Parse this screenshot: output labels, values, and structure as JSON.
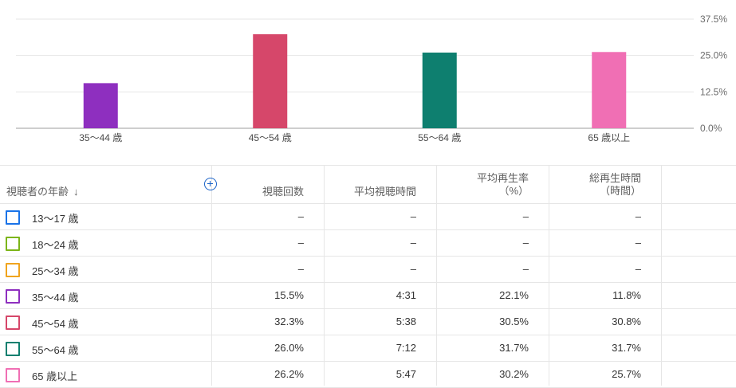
{
  "chart_data": {
    "type": "bar",
    "categories": [
      "35～44 歳",
      "45～54 歳",
      "55～64 歳",
      "65 歳以上"
    ],
    "values": [
      15.5,
      32.3,
      26.0,
      26.2
    ],
    "colors": [
      "#8e2fbf",
      "#d6476a",
      "#0e7f6f",
      "#f06fb4"
    ],
    "yticks": [
      "37.5%",
      "25.0%",
      "12.5%",
      "0.0%"
    ],
    "ylim": [
      0,
      37.5
    ],
    "grid": true
  },
  "table": {
    "headers": {
      "age": "視聴者の年齢",
      "views": "視聴回数",
      "avg_duration": "平均視聴時間",
      "avg_pct_1": "平均再生率",
      "avg_pct_2": "（%）",
      "watch_time_1": "総再生時間",
      "watch_time_2": "（時間）"
    },
    "sort_icon": "arrow-down-icon",
    "add_icon": "add-circle-icon",
    "rows": [
      {
        "label": "13～17 歳",
        "color": "#1a73e8",
        "views": "–",
        "avg_duration": "–",
        "avg_pct": "–",
        "watch_time": "–"
      },
      {
        "label": "18～24 歳",
        "color": "#7cb518",
        "views": "–",
        "avg_duration": "–",
        "avg_pct": "–",
        "watch_time": "–"
      },
      {
        "label": "25～34 歳",
        "color": "#f0a41e",
        "views": "–",
        "avg_duration": "–",
        "avg_pct": "–",
        "watch_time": "–"
      },
      {
        "label": "35～44 歳",
        "color": "#8e2fbf",
        "views": "15.5%",
        "avg_duration": "4:31",
        "avg_pct": "22.1%",
        "watch_time": "11.8%"
      },
      {
        "label": "45～54 歳",
        "color": "#d6476a",
        "views": "32.3%",
        "avg_duration": "5:38",
        "avg_pct": "30.5%",
        "watch_time": "30.8%"
      },
      {
        "label": "55～64 歳",
        "color": "#0e7f6f",
        "views": "26.0%",
        "avg_duration": "7:12",
        "avg_pct": "31.7%",
        "watch_time": "31.7%"
      },
      {
        "label": "65 歳以上",
        "color": "#f06fb4",
        "views": "26.2%",
        "avg_duration": "5:47",
        "avg_pct": "30.2%",
        "watch_time": "25.7%"
      }
    ]
  }
}
